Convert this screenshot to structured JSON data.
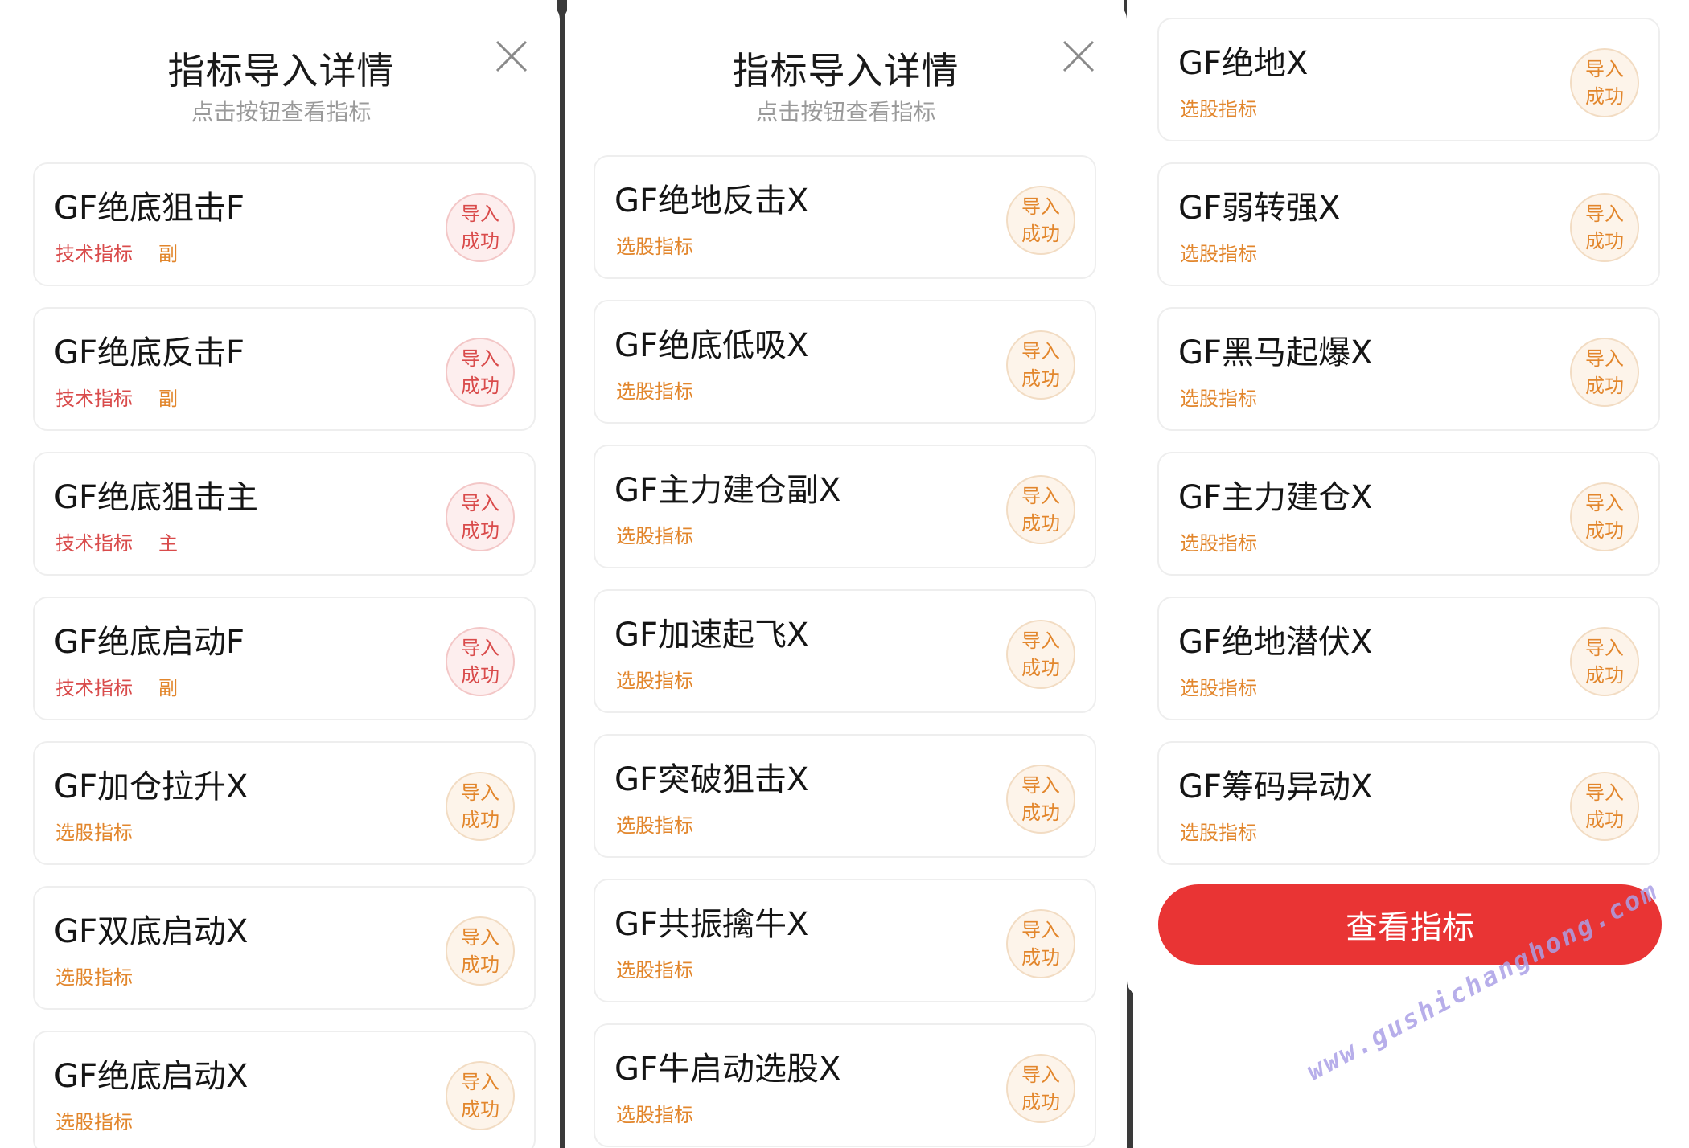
{
  "panel1": {
    "title": "指标导入详情",
    "subtitle": "点击按钮查看指标",
    "items": [
      {
        "name": "GF绝底狙击F",
        "tags": [
          {
            "text": "技术指标",
            "kind": "tech"
          },
          {
            "text": "副",
            "kind": "sub"
          }
        ],
        "status": [
          "导入",
          "成功"
        ],
        "style": "red"
      },
      {
        "name": "GF绝底反击F",
        "tags": [
          {
            "text": "技术指标",
            "kind": "tech"
          },
          {
            "text": "副",
            "kind": "sub"
          }
        ],
        "status": [
          "导入",
          "成功"
        ],
        "style": "red"
      },
      {
        "name": "GF绝底狙击主",
        "tags": [
          {
            "text": "技术指标",
            "kind": "tech"
          },
          {
            "text": "主",
            "kind": "main"
          }
        ],
        "status": [
          "导入",
          "成功"
        ],
        "style": "red"
      },
      {
        "name": "GF绝底启动F",
        "tags": [
          {
            "text": "技术指标",
            "kind": "tech"
          },
          {
            "text": "副",
            "kind": "sub"
          }
        ],
        "status": [
          "导入",
          "成功"
        ],
        "style": "red"
      },
      {
        "name": "GF加仓拉升X",
        "tags": [
          {
            "text": "选股指标",
            "kind": "select"
          }
        ],
        "status": [
          "导入",
          "成功"
        ],
        "style": "orange"
      },
      {
        "name": "GF双底启动X",
        "tags": [
          {
            "text": "选股指标",
            "kind": "select"
          }
        ],
        "status": [
          "导入",
          "成功"
        ],
        "style": "orange"
      },
      {
        "name": "GF绝底启动X",
        "tags": [
          {
            "text": "选股指标",
            "kind": "select"
          }
        ],
        "status": [
          "导入",
          "成功"
        ],
        "style": "orange"
      }
    ]
  },
  "panel2": {
    "title": "指标导入详情",
    "subtitle": "点击按钮查看指标",
    "items": [
      {
        "name": "GF绝地反击X",
        "tags": [
          {
            "text": "选股指标",
            "kind": "select"
          }
        ],
        "status": [
          "导入",
          "成功"
        ],
        "style": "orange"
      },
      {
        "name": "GF绝底低吸X",
        "tags": [
          {
            "text": "选股指标",
            "kind": "select"
          }
        ],
        "status": [
          "导入",
          "成功"
        ],
        "style": "orange"
      },
      {
        "name": "GF主力建仓副X",
        "tags": [
          {
            "text": "选股指标",
            "kind": "select"
          }
        ],
        "status": [
          "导入",
          "成功"
        ],
        "style": "orange"
      },
      {
        "name": "GF加速起飞X",
        "tags": [
          {
            "text": "选股指标",
            "kind": "select"
          }
        ],
        "status": [
          "导入",
          "成功"
        ],
        "style": "orange"
      },
      {
        "name": "GF突破狙击X",
        "tags": [
          {
            "text": "选股指标",
            "kind": "select"
          }
        ],
        "status": [
          "导入",
          "成功"
        ],
        "style": "orange"
      },
      {
        "name": "GF共振擒牛X",
        "tags": [
          {
            "text": "选股指标",
            "kind": "select"
          }
        ],
        "status": [
          "导入",
          "成功"
        ],
        "style": "orange"
      },
      {
        "name": "GF牛启动选股X",
        "tags": [
          {
            "text": "选股指标",
            "kind": "select"
          }
        ],
        "status": [
          "导入",
          "成功"
        ],
        "style": "orange"
      }
    ]
  },
  "panel3": {
    "items": [
      {
        "name": "GF绝地X",
        "tags": [
          {
            "text": "选股指标",
            "kind": "select"
          }
        ],
        "status": [
          "导入",
          "成功"
        ],
        "style": "orange"
      },
      {
        "name": "GF弱转强X",
        "tags": [
          {
            "text": "选股指标",
            "kind": "select"
          }
        ],
        "status": [
          "导入",
          "成功"
        ],
        "style": "orange"
      },
      {
        "name": "GF黑马起爆X",
        "tags": [
          {
            "text": "选股指标",
            "kind": "select"
          }
        ],
        "status": [
          "导入",
          "成功"
        ],
        "style": "orange"
      },
      {
        "name": "GF主力建仓X",
        "tags": [
          {
            "text": "选股指标",
            "kind": "select"
          }
        ],
        "status": [
          "导入",
          "成功"
        ],
        "style": "orange"
      },
      {
        "name": "GF绝地潜伏X",
        "tags": [
          {
            "text": "选股指标",
            "kind": "select"
          }
        ],
        "status": [
          "导入",
          "成功"
        ],
        "style": "orange"
      },
      {
        "name": "GF筹码异动X",
        "tags": [
          {
            "text": "选股指标",
            "kind": "select"
          }
        ],
        "status": [
          "导入",
          "成功"
        ],
        "style": "orange"
      }
    ],
    "view_button_label": "查看指标"
  },
  "watermark": "www.gushichanghong.com",
  "colors": {
    "primary_red": "#e93434",
    "tag_red": "#d94b4b",
    "tag_orange": "#e2862c"
  },
  "icons": {
    "close": "close-icon"
  }
}
